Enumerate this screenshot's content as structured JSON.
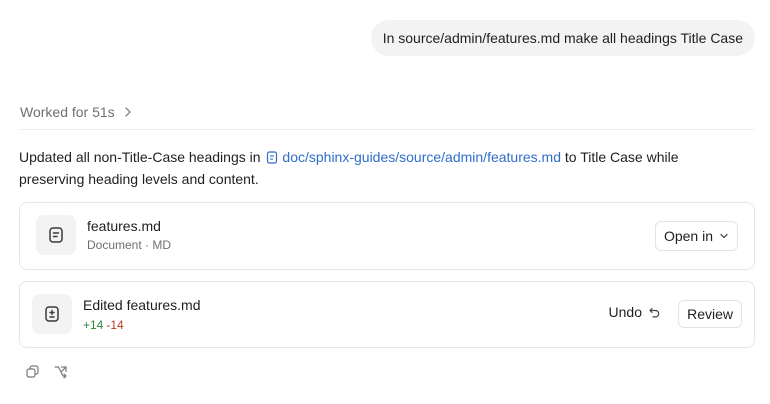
{
  "user_message": "In source/admin/features.md make all headings Title Case",
  "worked": {
    "label": "Worked for 51s",
    "icon": "chevron-right-icon"
  },
  "summary": {
    "before": "Updated all non-Title-Case headings in ",
    "file_link": "doc/sphinx-guides/source/admin/features.md",
    "after": " to Title Case while preserving heading levels and content."
  },
  "document_card": {
    "icon": "document-icon",
    "title": "features.md",
    "subtitle": "Document · MD",
    "open_label": "Open in"
  },
  "edit_card": {
    "icon": "diff-icon",
    "title": "Edited features.md",
    "additions": "+14",
    "deletions": "-14",
    "undo_label": "Undo",
    "review_label": "Review"
  },
  "footer_icons": [
    "copy-icon",
    "share-icon"
  ],
  "colors": {
    "link": "#2f6ecb",
    "add": "#2e8b3a",
    "del": "#c0392b"
  }
}
